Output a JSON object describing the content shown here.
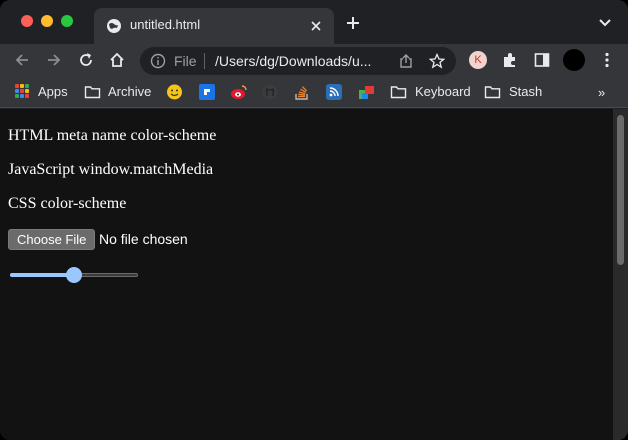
{
  "browser": {
    "tab": {
      "title": "untitled.html",
      "icon": "globe-icon"
    },
    "omnibox": {
      "scheme_label": "File",
      "url": "/Users/dg/Downloads/u..."
    },
    "profile_badge": "K",
    "bookmarks": [
      {
        "label": "Apps",
        "icon": "apps-grid-icon"
      },
      {
        "label": "Archive",
        "icon": "folder-icon"
      },
      {
        "label": "",
        "icon": "emoji-icon"
      },
      {
        "label": "",
        "icon": "blue-square-icon"
      },
      {
        "label": "",
        "icon": "weibo-icon"
      },
      {
        "label": "",
        "icon": "github-icon"
      },
      {
        "label": "",
        "icon": "stackoverflow-icon"
      },
      {
        "label": "",
        "icon": "rss-icon"
      },
      {
        "label": "",
        "icon": "puzzle-app-icon"
      },
      {
        "label": "Keyboard",
        "icon": "folder-icon"
      },
      {
        "label": "Stash",
        "icon": "folder-icon"
      }
    ],
    "colors": {
      "tab_bg": "#35363a",
      "frame_bg": "#202124",
      "page_bg": "#121212"
    }
  },
  "page": {
    "line1": "HTML meta name color-scheme",
    "line2": "JavaScript window.matchMedia",
    "line3": "CSS color-scheme",
    "file_input": {
      "button_label": "Choose File",
      "status": "No file chosen"
    },
    "range_value": 0.5,
    "accent": "#99c8ff"
  }
}
